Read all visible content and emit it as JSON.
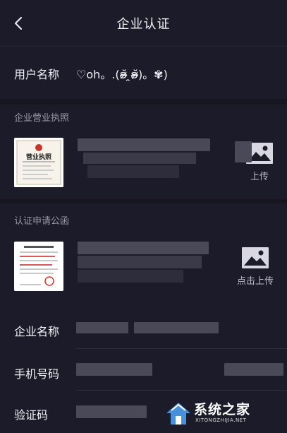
{
  "nav": {
    "title": "企业认证"
  },
  "user": {
    "label": "用户名称",
    "value": "♡oh。.(ʚ̴̶̷̆ ̯ʚ̴̶̷̆)。✾)"
  },
  "license": {
    "section_label": "企业营业执照",
    "thumb_title": "营业执照",
    "upload_label": "上传"
  },
  "letter": {
    "section_label": "认证申请公函",
    "upload_label": "点击上传"
  },
  "form": {
    "company_label": "企业名称",
    "phone_label": "手机号码",
    "code_label": "验证码"
  },
  "watermark": {
    "title": "系统之家",
    "url": "XITONGZHIJIA.NET"
  }
}
